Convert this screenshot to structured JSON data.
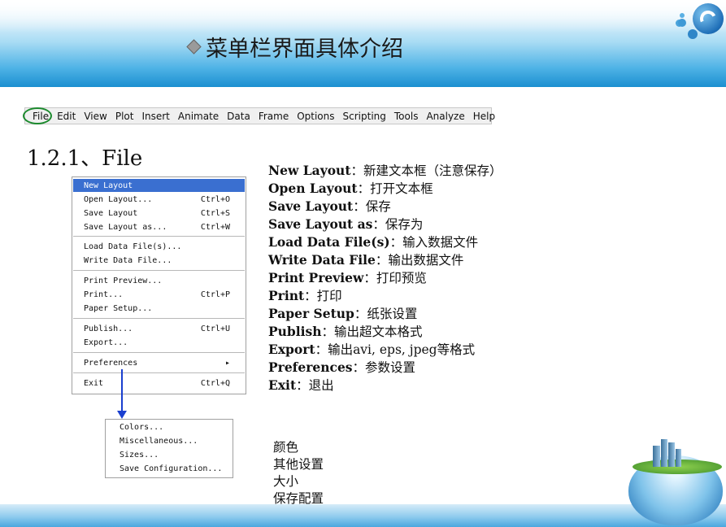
{
  "slide": {
    "title": "菜单栏界面具体介绍",
    "section_heading": "1.2.1、File"
  },
  "menubar": {
    "items": [
      "File",
      "Edit",
      "View",
      "Plot",
      "Insert",
      "Animate",
      "Data",
      "Frame",
      "Options",
      "Scripting",
      "Tools",
      "Analyze",
      "Help"
    ],
    "highlight_color": "#1c8a2e"
  },
  "file_menu": {
    "items": [
      {
        "label": "New Layout",
        "shortcut": "",
        "selected": true
      },
      {
        "label": "Open Layout...",
        "shortcut": "Ctrl+O"
      },
      {
        "label": "Save Layout",
        "shortcut": "Ctrl+S"
      },
      {
        "label": "Save Layout as...",
        "shortcut": "Ctrl+W"
      },
      {
        "label": "Load Data File(s)...",
        "shortcut": ""
      },
      {
        "label": "Write Data File...",
        "shortcut": ""
      },
      {
        "label": "Print Preview...",
        "shortcut": ""
      },
      {
        "label": "Print...",
        "shortcut": "Ctrl+P"
      },
      {
        "label": "Paper Setup...",
        "shortcut": ""
      },
      {
        "label": "Publish...",
        "shortcut": "Ctrl+U"
      },
      {
        "label": "Export...",
        "shortcut": ""
      },
      {
        "label": "Preferences",
        "shortcut": "▸"
      },
      {
        "label": "Exit",
        "shortcut": "Ctrl+Q"
      }
    ],
    "selected_color": "#3a6fd0"
  },
  "preferences_submenu": {
    "items": [
      "Colors...",
      "Miscellaneous...",
      "Sizes...",
      "Save Configuration..."
    ],
    "arrow_color": "#1a3fcf"
  },
  "descriptions": [
    {
      "term": "New Layout",
      "text": "：新建文本框（注意保存）"
    },
    {
      "term": "Open Layout",
      "text": "：打开文本框"
    },
    {
      "term": "Save Layout",
      "text": "：保存"
    },
    {
      "term": "Save Layout as",
      "text": "：保存为"
    },
    {
      "term": "Load Data File(s)",
      "text": "：输入数据文件"
    },
    {
      "term": "Write Data File",
      "text": "：输出数据文件"
    },
    {
      "term": "Print Preview",
      "text": "：打印预览"
    },
    {
      "term": "Print",
      "text": "：打印"
    },
    {
      "term": "Paper Setup",
      "text": "：纸张设置"
    },
    {
      "term": "Publish",
      "text": "：输出超文本格式"
    },
    {
      "term": "Export",
      "text": "：输出avi, eps, jpeg等格式"
    },
    {
      "term": "Preferences",
      "text": "：参数设置"
    },
    {
      "term": "Exit",
      "text": "：退出"
    }
  ],
  "preferences_descriptions": [
    "颜色",
    "其他设置",
    "大小",
    "保存配置"
  ]
}
